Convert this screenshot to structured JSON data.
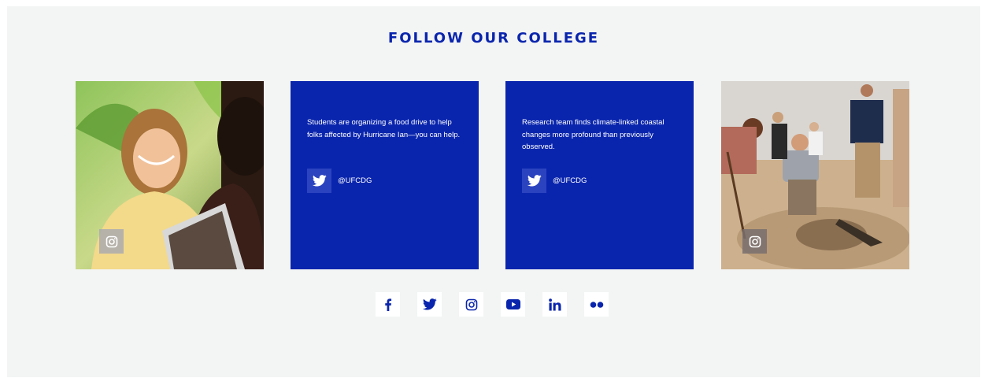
{
  "section": {
    "title": "FOLLOW OUR COLLEGE"
  },
  "posts": [
    {
      "type": "instagram",
      "image": "student-laptop-photo",
      "icon": "instagram-icon"
    },
    {
      "type": "twitter",
      "text": "Students are organizing a food drive to help folks affected by Hurricane Ian—you can help.",
      "handle": "@UFCDG",
      "icon": "twitter-icon"
    },
    {
      "type": "twitter",
      "text": "Research team finds climate-linked coastal changes more profound than previously observed.",
      "handle": "@UFCDG",
      "icon": "twitter-icon"
    },
    {
      "type": "instagram",
      "image": "beach-dig-photo",
      "icon": "instagram-icon"
    }
  ],
  "social_links": [
    "facebook-icon",
    "twitter-icon",
    "instagram-icon",
    "youtube-icon",
    "linkedin-icon",
    "flickr-icon"
  ],
  "colors": {
    "brand_blue": "#0a25ad",
    "panel_bg": "#f3f4f4",
    "tile_icon_bg": "#2b43bf"
  }
}
